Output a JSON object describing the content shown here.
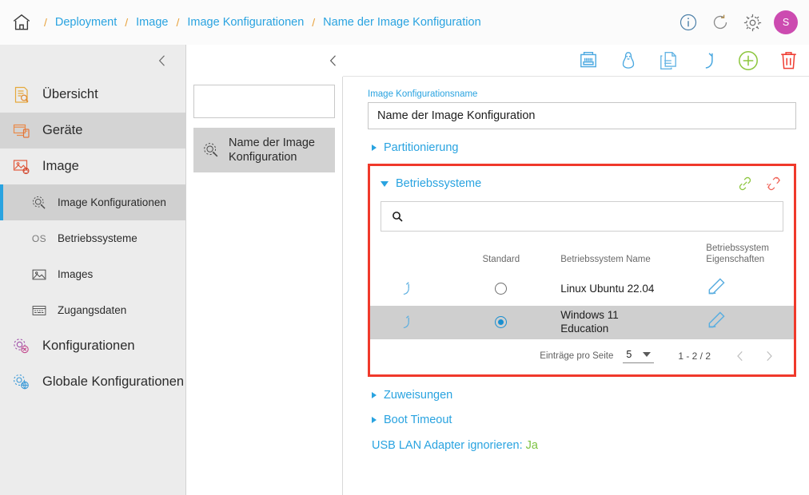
{
  "topbar": {
    "home_icon": "home-icon",
    "breadcrumbs": [
      {
        "label": "Deployment"
      },
      {
        "label": "Image"
      },
      {
        "label": "Image Konfigurationen"
      },
      {
        "label": "Name der Image Konfiguration"
      }
    ],
    "separator": "/",
    "actions": [
      {
        "name": "info-icon",
        "title": "Info"
      },
      {
        "name": "refresh-icon",
        "title": "Aktualisieren"
      },
      {
        "name": "gear-icon",
        "title": "Einstellungen"
      }
    ],
    "avatar_initial": "S",
    "avatar_color": "#cc4bb0"
  },
  "sidebar": {
    "collapse_icon": "chevron-left-icon",
    "items": [
      {
        "label": "Übersicht",
        "icon": "overview-icon",
        "highlighted": false
      },
      {
        "label": "Geräte",
        "icon": "devices-icon",
        "highlighted": true
      },
      {
        "label": "Image",
        "icon": "image-icon",
        "highlighted": false
      }
    ],
    "subitems": [
      {
        "label": "Image Konfigurationen",
        "icon": "image-config-icon",
        "active": true
      },
      {
        "label": "Betriebssysteme",
        "icon": "os-icon",
        "active": false
      },
      {
        "label": "Images",
        "icon": "picture-icon",
        "active": false
      },
      {
        "label": "Zugangsdaten",
        "icon": "credentials-icon",
        "active": false
      }
    ],
    "items_bottom": [
      {
        "label": "Konfigurationen",
        "icon": "configurations-icon"
      },
      {
        "label": "Globale Konfigurationen",
        "icon": "global-configurations-icon"
      }
    ],
    "accent_color": "#29a3e0"
  },
  "listpanel": {
    "search_placeholder": "",
    "search_value": "",
    "entry": {
      "label": "Name der Image Konfiguration",
      "icon": "image-config-icon"
    }
  },
  "main": {
    "back_icon": "chevron-left-icon",
    "toolbar": [
      {
        "name": "lan-port-icon",
        "title": "LAN"
      },
      {
        "name": "linux-penguin-icon",
        "title": "Linux"
      },
      {
        "name": "duplicate-icon",
        "title": "Duplizieren"
      },
      {
        "name": "undo-icon",
        "title": "Rückgängig"
      },
      {
        "name": "add-circle-icon",
        "title": "Hinzufügen"
      },
      {
        "name": "delete-trash-icon",
        "title": "Löschen"
      }
    ],
    "name_field": {
      "label": "Image Konfigurationsname",
      "value": "Name der Image Konfiguration",
      "placeholder": ""
    },
    "sections": [
      {
        "label": "Partitionierung",
        "expanded": false
      },
      {
        "label": "Zuweisungen",
        "expanded": false
      },
      {
        "label": "Boot Timeout",
        "expanded": false
      }
    ],
    "os_section": {
      "label": "Betriebssysteme",
      "expanded": true,
      "link_icon": "link-icon",
      "unlink_icon": "unlink-icon",
      "link_color": "#8dc63f",
      "unlink_color": "#f0655a",
      "highlight_color": "#f0392b",
      "search_value": "",
      "search_placeholder": "",
      "columns": [
        "",
        "Standard",
        "Betriebssystem Name",
        "Betriebssystem Eigenschaften"
      ],
      "rows": [
        {
          "reset_icon": "restore-icon",
          "standard": false,
          "name": "Linux Ubuntu 22.04",
          "edit_icon": "pencil-icon",
          "selected": false
        },
        {
          "reset_icon": "restore-icon",
          "standard": true,
          "name": "Windows 11 Education",
          "edit_icon": "pencil-icon",
          "selected": true
        }
      ],
      "pagination": {
        "per_page_label": "Einträge pro Seite",
        "per_page_value": "5",
        "range": "1 - 2 / 2",
        "prev_icon": "chevron-left-icon",
        "next_icon": "chevron-right-icon"
      }
    },
    "usb_row": {
      "label": "USB LAN Adapter ignorieren:",
      "value": "Ja",
      "value_color": "#7dc242"
    }
  }
}
